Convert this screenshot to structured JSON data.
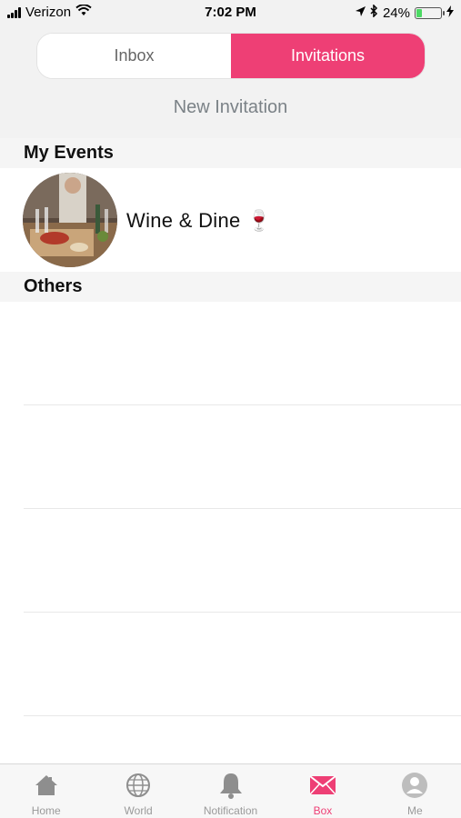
{
  "status_bar": {
    "carrier": "Verizon",
    "time": "7:02 PM",
    "battery": "24%",
    "battery_level": 0.24,
    "icons": [
      "signal-icon",
      "wifi-icon",
      "location-icon",
      "bluetooth-icon",
      "battery-icon",
      "charging-icon"
    ]
  },
  "segmented": {
    "tabs": [
      {
        "label": "Inbox",
        "selected": false
      },
      {
        "label": "Invitations",
        "selected": true
      }
    ],
    "accent_color": "#ee3f75"
  },
  "new_invitation_label": "New Invitation",
  "sections": {
    "my_events": {
      "title": "My Events",
      "items": [
        {
          "title": "Wine & Dine 🍷",
          "image": "event-photo"
        }
      ]
    },
    "others": {
      "title": "Others",
      "items": []
    }
  },
  "tab_bar": {
    "items": [
      {
        "label": "Home",
        "icon": "home-icon",
        "active": false
      },
      {
        "label": "World",
        "icon": "globe-icon",
        "active": false
      },
      {
        "label": "Notification",
        "icon": "bell-icon",
        "active": false
      },
      {
        "label": "Box",
        "icon": "mail-icon",
        "active": true
      },
      {
        "label": "Me",
        "icon": "user-icon",
        "active": false
      }
    ]
  }
}
